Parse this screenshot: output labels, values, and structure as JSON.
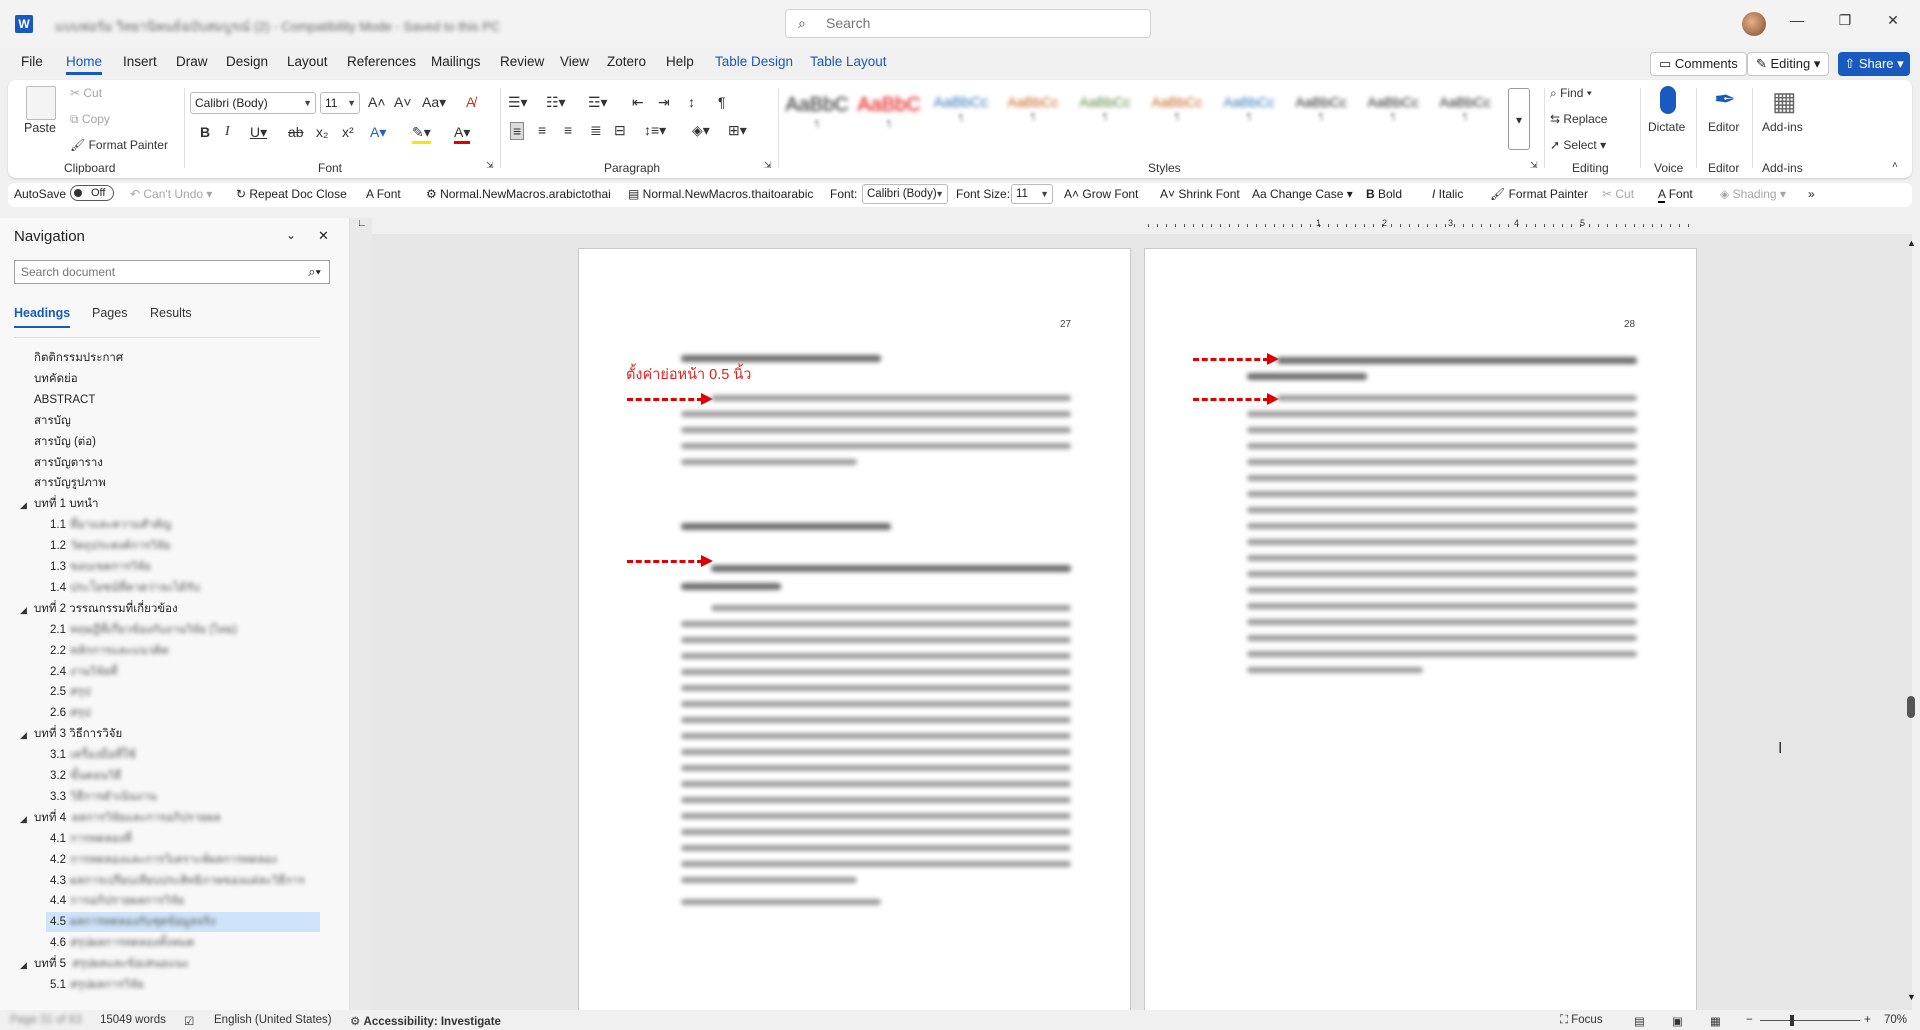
{
  "titlebar": {
    "logo": "W",
    "doc_title": "แบบฟอร์ม วิทยานิพนธ์ฉบับสมบูรณ์ (2) - Compatibility Mode - Saved to this PC",
    "search_placeholder": "Search",
    "window_controls": [
      "minimize-icon",
      "restore-icon",
      "close-icon"
    ]
  },
  "menu": {
    "items": [
      "File",
      "Home",
      "Insert",
      "Draw",
      "Design",
      "Layout",
      "References",
      "Mailings",
      "Review",
      "View",
      "Zotero",
      "Help",
      "Table Design",
      "Table Layout"
    ],
    "active": "Home",
    "comments": "Comments",
    "editing": "Editing",
    "share": "Share"
  },
  "ribbon": {
    "clipboard": {
      "paste": "Paste",
      "cut": "Cut",
      "copy": "Copy",
      "format_painter": "Format Painter",
      "label": "Clipboard"
    },
    "font": {
      "name": "Calibri (Body)",
      "size": "11",
      "label": "Font"
    },
    "paragraph": {
      "label": "Paragraph"
    },
    "styles": {
      "label": "Styles",
      "items": [
        "AaBbC",
        "AaBbC",
        "AaBbCc",
        "AaBbCc",
        "AaBbCc",
        "AaBbCc",
        "AaBbCc",
        "AaBbCc",
        "AaBbCc",
        "AaBbCc"
      ]
    },
    "editing": {
      "find": "Find",
      "replace": "Replace",
      "select": "Select",
      "label": "Editing"
    },
    "voice": {
      "dictate": "Dictate",
      "label": "Voice"
    },
    "editor": {
      "button": "Editor",
      "label": "Editor"
    },
    "addins": {
      "button": "Add-ins",
      "label": "Add-ins"
    }
  },
  "qat": {
    "autosave": "AutoSave",
    "autosave_state": "Off",
    "cant_undo": "Can't Undo",
    "repeat": "Repeat Doc Close",
    "font": "Font",
    "macro1": "Normal.NewMacros.arabictothai",
    "macro2": "Normal.NewMacros.thaitoarabic",
    "font_label": "Font:",
    "font_value": "Calibri (Body)",
    "size_label": "Font Size:",
    "size_value": "11",
    "grow": "Grow Font",
    "shrink": "Shrink Font",
    "change_case": "Change Case",
    "bold": "Bold",
    "italic": "Italic",
    "format_painter": "Format Painter",
    "cut": "Cut",
    "font2": "Font",
    "shading": "Shading"
  },
  "nav": {
    "title": "Navigation",
    "search_placeholder": "Search document",
    "tabs": [
      "Headings",
      "Pages",
      "Results"
    ],
    "items": [
      {
        "text": "กิตติกรรมประกาศ",
        "level": 0
      },
      {
        "text": "บทคัดย่อ",
        "level": 0
      },
      {
        "text": "ABSTRACT",
        "level": 0
      },
      {
        "text": "สารบัญ",
        "level": 0
      },
      {
        "text": "สารบัญ (ต่อ)",
        "level": 0
      },
      {
        "text": "สารบัญตาราง",
        "level": 0
      },
      {
        "text": "สารบัญรูปภาพ",
        "level": 0
      },
      {
        "text": "บทที่ 1  บทนำ",
        "level": 0,
        "caret": true
      },
      {
        "num": "1.1",
        "text": "ที่มาและความสำคัญ",
        "level": 1
      },
      {
        "num": "1.2",
        "text": "วัตถุประสงค์การวิจัย",
        "level": 1
      },
      {
        "num": "1.3",
        "text": "ขอบเขตการวิจัย",
        "level": 1
      },
      {
        "num": "1.4",
        "text": "ประโยชน์ที่คาดว่าจะได้รับ",
        "level": 1
      },
      {
        "text": "บทที่ 2  วรรณกรรมที่เกี่ยวข้อง",
        "level": 0,
        "caret": true
      },
      {
        "num": "2.1",
        "text": "ทฤษฎีที่เกี่ยวข้องกับงานวิจัย (ไทย)",
        "level": 1
      },
      {
        "num": "2.2",
        "text": "หลักการและแนวคิด",
        "level": 1
      },
      {
        "num": "2.4",
        "text": "งานวิจัยที่",
        "level": 1
      },
      {
        "num": "2.5",
        "text": "สรุป",
        "level": 1
      },
      {
        "num": "2.6",
        "text": "สรุป",
        "level": 1
      },
      {
        "text": "บทที่ 3  วิธีการวิจัย",
        "level": 0,
        "caret": true
      },
      {
        "num": "3.1",
        "text": "เครื่องมือที่ใช้",
        "level": 1
      },
      {
        "num": "3.2",
        "text": "ขั้นตอนวิธี",
        "level": 1
      },
      {
        "num": "3.3",
        "text": "วิธีการดำเนินงาน",
        "level": 1
      },
      {
        "text": "บทที่ 4",
        "blur_text": "ผลการวิจัยและการอภิปรายผล",
        "level": 0,
        "caret": true
      },
      {
        "num": "4.1",
        "text": "การทดลองที่",
        "level": 1
      },
      {
        "num": "4.2",
        "text": "การทดลองและการวิเคราะห์ผลการทดลอง",
        "level": 1
      },
      {
        "num": "4.3",
        "text": "ผลการเปรียบเทียบประสิทธิภาพของแต่ละวิธีการ",
        "level": 1
      },
      {
        "num": "4.4",
        "text": "การอภิปรายผลการวิจัย",
        "level": 1
      },
      {
        "num": "4.5",
        "text": "ผลการทดลองกับชุดข้อมูลจริง",
        "level": 1,
        "selected": true
      },
      {
        "num": "4.6",
        "text": "สรุปผลการทดลองทั้งหมด",
        "level": 1
      },
      {
        "text": "บทที่ 5",
        "blur_text": "สรุปผลและข้อเสนอแนะ",
        "level": 0,
        "caret": true
      },
      {
        "num": "5.1",
        "text": "สรุปผลการวิจัย",
        "level": 1
      }
    ]
  },
  "ruler": {
    "numbers": [
      "1",
      "2",
      "3",
      "4",
      "5"
    ]
  },
  "pages": {
    "left_number": "27",
    "right_number": "28",
    "annotation": "ตั้งค่าย่อหน้า 0.5 นิ้ว"
  },
  "status": {
    "page": "Page 31 of 63",
    "words": "15049 words",
    "language": "English (United States)",
    "accessibility": "Accessibility: Investigate",
    "focus": "Focus",
    "zoom": "70%"
  }
}
